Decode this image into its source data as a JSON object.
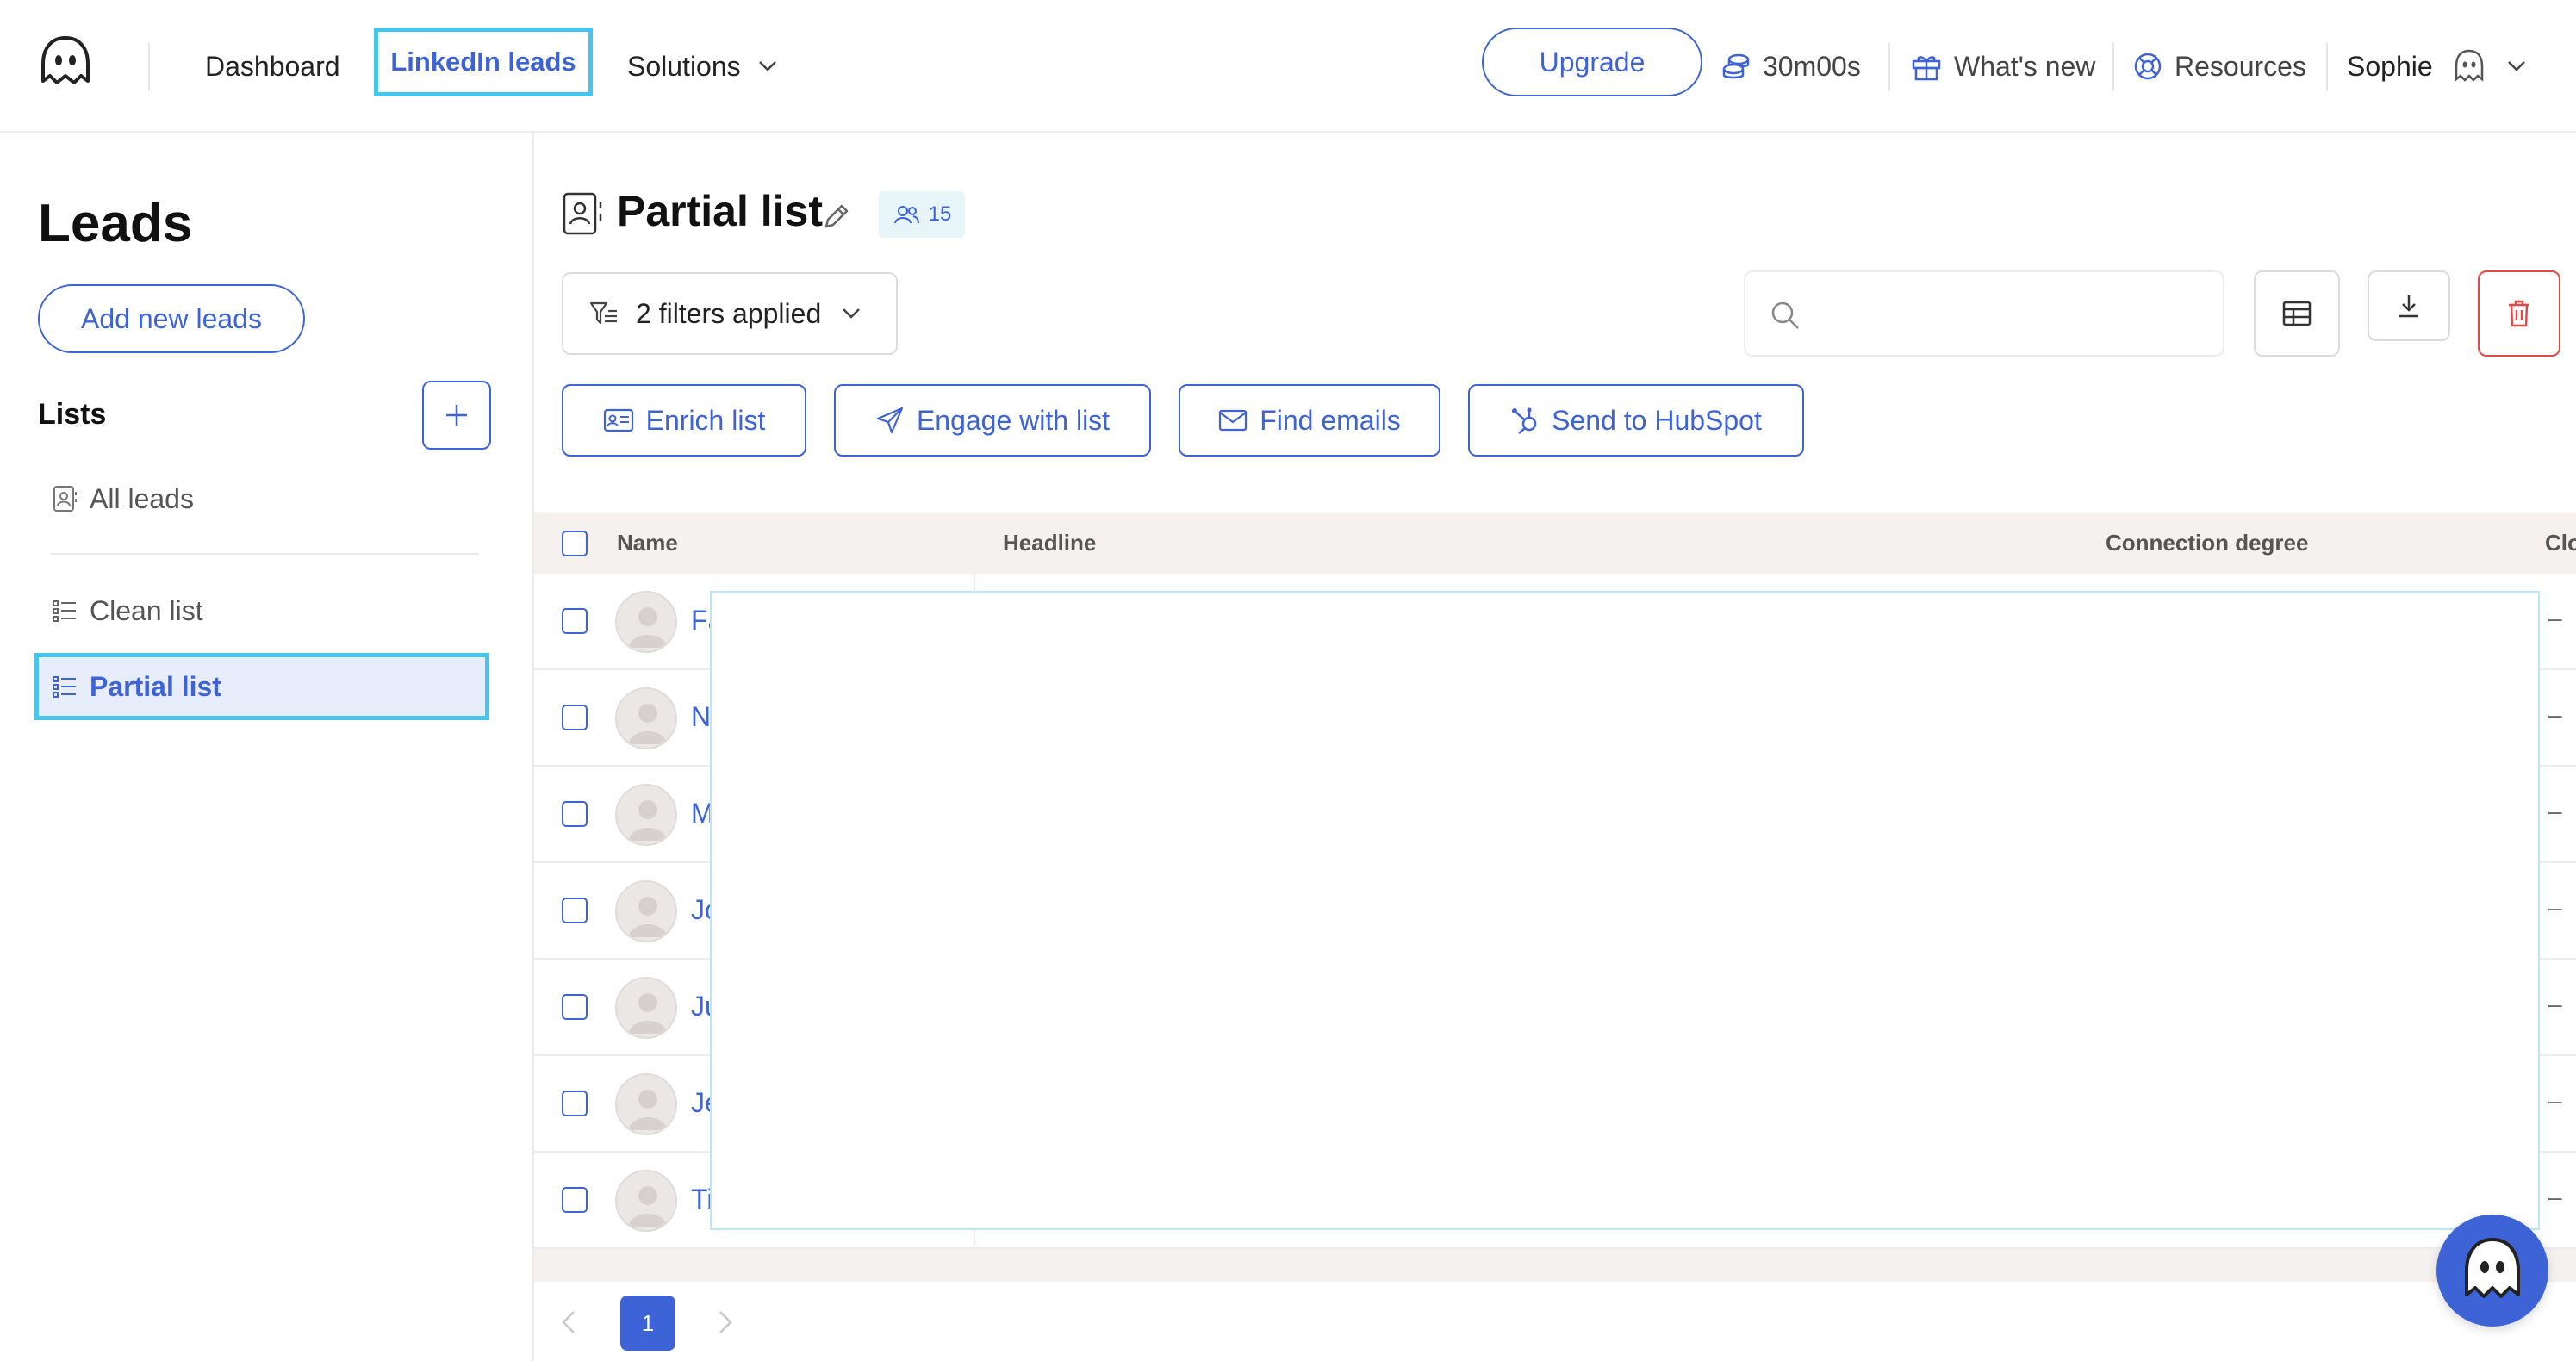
{
  "nav": {
    "dashboard": "Dashboard",
    "linkedin_leads": "LinkedIn leads",
    "solutions": "Solutions",
    "upgrade": "Upgrade",
    "credits": "30m00s",
    "whats_new": "What's new",
    "resources": "Resources",
    "user_name": "Sophie"
  },
  "sidebar": {
    "title": "Leads",
    "add_button": "Add new leads",
    "lists_title": "Lists",
    "items": [
      {
        "label": "All leads"
      },
      {
        "label": "Clean list"
      },
      {
        "label": "Partial list"
      }
    ]
  },
  "main": {
    "title": "Partial list",
    "member_count": "15",
    "filters_label": "2 filters applied",
    "search_placeholder": "",
    "actions": {
      "enrich": "Enrich list",
      "engage": "Engage with list",
      "find_emails": "Find emails",
      "hubspot": "Send to HubSpot"
    }
  },
  "table": {
    "columns": [
      "Name",
      "Headline",
      "Connection degree",
      "Clo"
    ],
    "rows": [
      {
        "name": "Fa",
        "value": "–"
      },
      {
        "name": "N",
        "value": "–"
      },
      {
        "name": "M",
        "value": "–"
      },
      {
        "name": "Jo",
        "value": "–"
      },
      {
        "name": "Ju",
        "value": "–"
      },
      {
        "name": "Je",
        "value": "–"
      },
      {
        "name": "Ti",
        "value": "–"
      }
    ]
  },
  "pagination": {
    "current": "1"
  },
  "colors": {
    "accent": "#3d63d6",
    "highlight": "#46c6ee",
    "danger": "#e24a4a"
  }
}
